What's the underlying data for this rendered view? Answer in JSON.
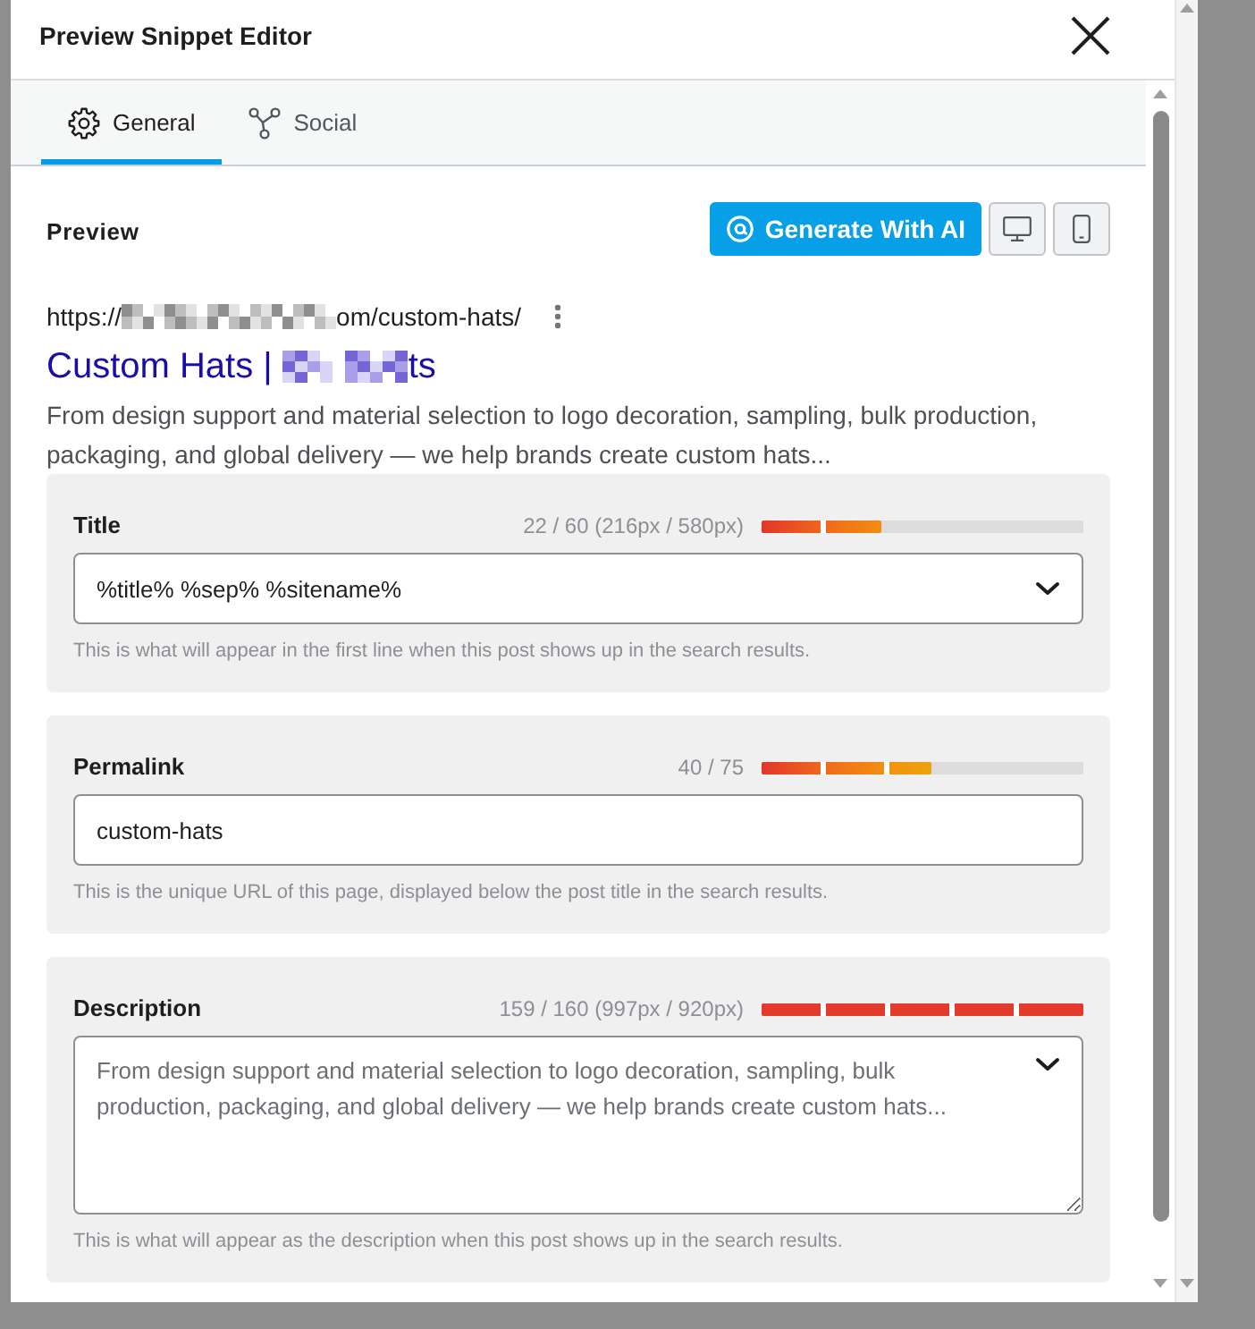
{
  "dialog": {
    "title": "Preview Snippet Editor"
  },
  "tabs": [
    {
      "label": "General",
      "selected": true
    },
    {
      "label": "Social",
      "selected": false
    }
  ],
  "preview": {
    "heading": "Preview",
    "ai_button": "Generate With AI",
    "url_start": "https://",
    "url_end": "om/custom-hats/",
    "title_start": "Custom Hats |",
    "title_end": "ts",
    "description": "From design support and material selection to logo decoration, sampling, bulk production, packaging, and global delivery — we help brands create custom hats..."
  },
  "fields": [
    {
      "kind": "select",
      "label": "Title",
      "counter": "22 / 60 (216px / 580px)",
      "level": 0.37,
      "over_limit": false,
      "value": "%title% %sep% %sitename%",
      "help": "This is what will appear in the first line when this post shows up in the search results."
    },
    {
      "kind": "input",
      "label": "Permalink",
      "counter": "40 / 75",
      "level": 0.53,
      "over_limit": false,
      "value": "custom-hats",
      "help": "This is the unique URL of this page, displayed below the post title in the search results."
    },
    {
      "kind": "textarea",
      "label": "Description",
      "counter": "159 / 160 (997px / 920px)",
      "level": 1,
      "over_limit": true,
      "placeholder": "From design support and material selection to logo decoration, sampling, bulk production, packaging, and global delivery — we help brands create custom hats...",
      "help": "This is what will appear as the description when this post shows up in the search results."
    }
  ]
}
